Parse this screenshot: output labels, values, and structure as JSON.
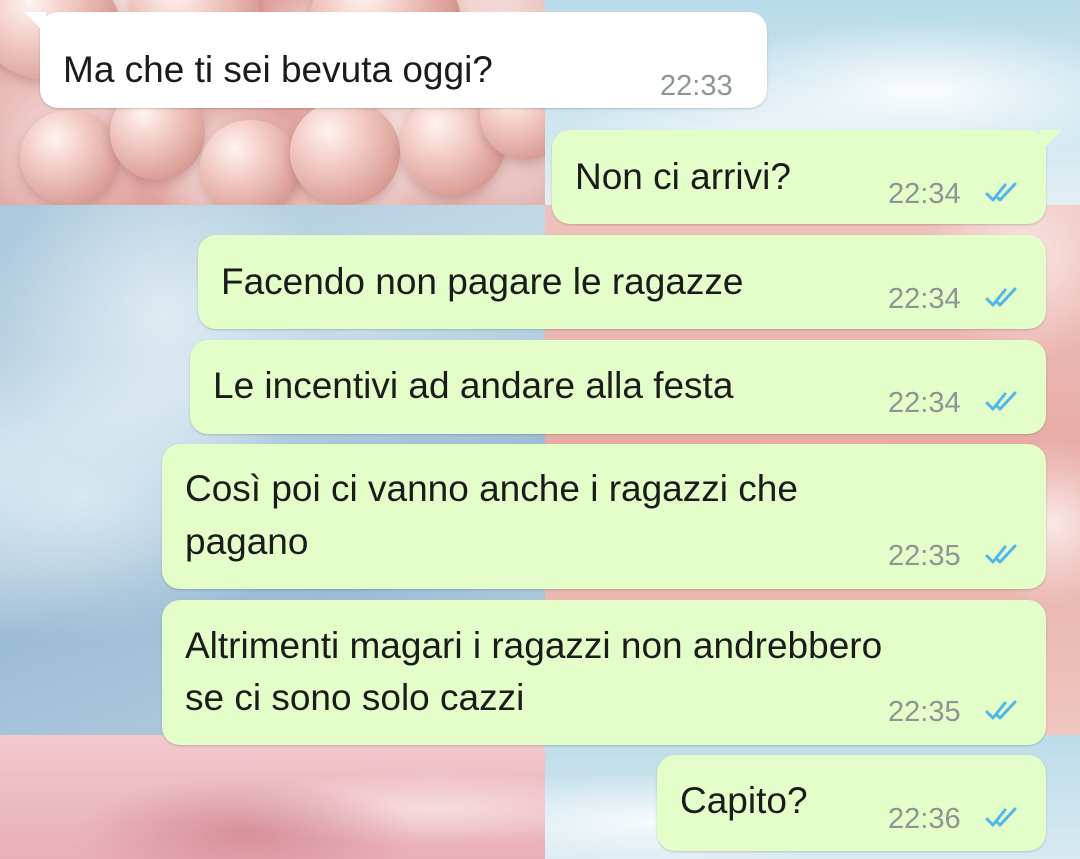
{
  "chat": {
    "messages": [
      {
        "direction": "incoming",
        "text": "Ma che ti sei bevuta oggi?",
        "time": "22:33"
      },
      {
        "direction": "outgoing",
        "text": "Non ci arrivi?",
        "time": "22:34",
        "status": "read"
      },
      {
        "direction": "outgoing",
        "text": "Facendo non pagare le ragazze",
        "time": "22:34",
        "status": "read"
      },
      {
        "direction": "outgoing",
        "text": "Le incentivi ad andare alla festa",
        "time": "22:34",
        "status": "read"
      },
      {
        "direction": "outgoing",
        "lines": [
          "Così poi ci vanno anche i ragazzi che",
          "pagano"
        ],
        "time": "22:35",
        "status": "read"
      },
      {
        "direction": "outgoing",
        "lines": [
          "Altrimenti magari i ragazzi non andrebbero",
          "se ci sono solo cazzi"
        ],
        "time": "22:35",
        "status": "read"
      },
      {
        "direction": "outgoing",
        "text": "Capito?",
        "time": "22:36",
        "status": "read"
      }
    ]
  },
  "colors": {
    "incoming_bubble": "#ffffff",
    "outgoing_bubble": "#e3fec9",
    "timestamp": "#8b9695",
    "read_ticks": "#4fb6ec"
  },
  "icons": {
    "read_receipt": "double-check-icon"
  }
}
